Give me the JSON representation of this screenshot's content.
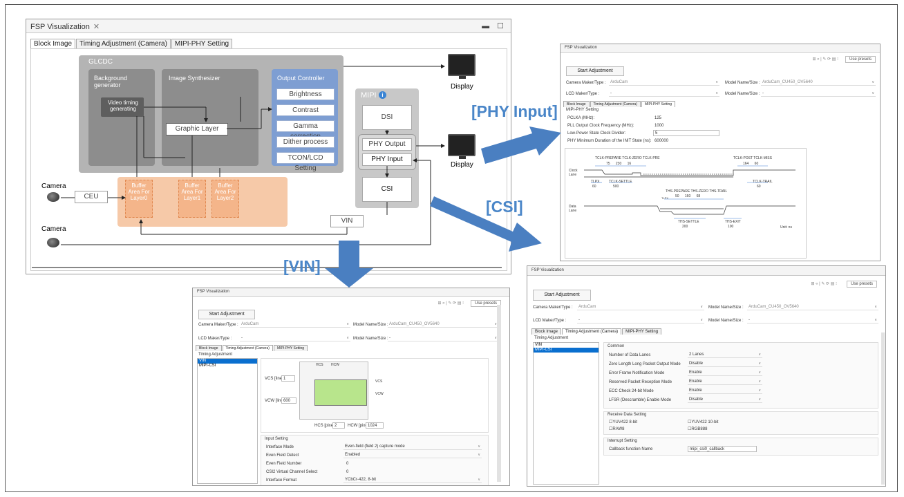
{
  "colors": {
    "accent_blue": "#4a86c8",
    "selection_blue": "#0a6fcf",
    "glcdc_gray": "#b4b4b4",
    "block_gray": "#8d8d8d",
    "output_blue": "#7e9ed2",
    "buffer_orange": "#f6c9a8"
  },
  "callouts": {
    "phy_input": "[PHY Input]",
    "csi": "[CSI]",
    "vin": "[VIN]"
  },
  "main_window": {
    "tab_title": "FSP Visualization",
    "close_glyph": "✕",
    "minmax": "▬ ☐",
    "tabs": [
      "Block Image",
      "Timing Adjustment (Camera)",
      "MIPI-PHY Setting"
    ],
    "diagram": {
      "glcdc": "GLCDC",
      "background_generator": "Background generator",
      "image_synthesizer": "Image Synthesizer",
      "video_timing": "Video timing generating",
      "graphic_layer": "Graphic Layer",
      "output_controller": "Output Controller",
      "oc_items": [
        "Brightness",
        "Contrast",
        "Gamma correction",
        "Dither process",
        "TCON/LCD Setting"
      ],
      "mipi": "MIPI",
      "mipi_info_icon": "i",
      "dsi": "DSI",
      "phy_output": "PHY Output",
      "phy_input": "PHY Input",
      "csi": "CSI",
      "vin": "VIN",
      "ceu": "CEU",
      "camera_top": "Camera",
      "camera_bottom": "Camera",
      "display_top": "Display",
      "display_bottom": "Display",
      "buffers": [
        "Buffer Area For Layer0",
        "Buffer Area For Layer1",
        "Buffer Area For Layer2"
      ]
    }
  },
  "phy_window": {
    "tab_title": "FSP Visualization",
    "use_presets": "Use presets",
    "start_adjustment": "Start Adjustment",
    "camera_maker_label": "Camera Maker/Type :",
    "camera_maker_value": "ArduCam",
    "model_name_label": "Model Name/Size :",
    "model_name_value": "ArduCam_CU450_OV5640",
    "lcd_maker_label": "LCD Maker/Type :",
    "lcd_maker_value": "-",
    "lcd_model_label": "Model Name/Size :",
    "lcd_model_value": "-",
    "tabs": [
      "Block Image",
      "Timing Adjustment (Camera)",
      "MIPI-PHY Setting"
    ],
    "section": "MIPI-PHY Setting",
    "rows": [
      {
        "label": "PCLKA (MHz):",
        "value": "125"
      },
      {
        "label": "PLL Output Clock Frequency (MHz):",
        "value": "1000"
      },
      {
        "label": "Low-Power State Clock Divider:",
        "value": "5"
      },
      {
        "label": "PHY Minimum Duration of the INIT State (ns):",
        "value": "600000"
      }
    ],
    "timing": {
      "clock_lane": "Clock Lane",
      "data_lane": "Data Lane",
      "top_labels": "TCLK-PREPARE TCLK-ZERO TCLK-PRE",
      "top_values": "75      230      16",
      "post_labels": "TCLK-POST TCLK-MISS",
      "post_values": "164      60",
      "tlpx": "TLPX",
      "tlpx_val": "60",
      "settle": "TCLK-SETTLE",
      "settle_val": "500",
      "trail": "TCLK-TRAIL",
      "trail_val": "60",
      "ths_labels": "THS-PREPARE THS-ZERO THS-TRAIL",
      "ths_values": "50      160      68",
      "tlpx2": "TLPX",
      "ths_settle": "THS-SETTLE",
      "ths_settle_val": "200",
      "ths_exit": "THS-EXIT",
      "ths_exit_val": "100",
      "unit": "Unit: ns"
    }
  },
  "vin_window": {
    "tab_title": "FSP Visualization",
    "use_presets": "Use presets",
    "start_adjustment": "Start Adjustment",
    "camera_maker_label": "Camera Maker/Type :",
    "camera_maker_value": "ArduCam",
    "model_name_label": "Model Name/Size :",
    "model_name_value": "ArduCam_CU450_OV5640",
    "lcd_maker_label": "LCD Maker/Type :",
    "lcd_maker_value": "-",
    "lcd_model_label": "Model Name/Size :",
    "lcd_model_value": "-",
    "tabs": [
      "Block Image",
      "Timing Adjustment (Camera)",
      "MIPI-PHY Setting"
    ],
    "section": "Timing Adjustment",
    "list": [
      "VIN",
      "MIPI-CSI"
    ],
    "vcs_label": "VCS [line]",
    "vcs_value": "1",
    "vcw_label": "VCW [line]",
    "vcw_value": "600",
    "hcs_label": "HCS [pixel]",
    "hcs_value": "2",
    "hcw_label": "HCW [pixel]",
    "hcw_value": "1024",
    "diag_hcs": "HCS",
    "diag_hcw": "HCW",
    "diag_vcs": "VCS",
    "diag_vcw": "VCW",
    "input_setting": "Input Setting",
    "rows": [
      {
        "label": "Interface Mode",
        "value": "Even-field (field 2) capture mode"
      },
      {
        "label": "Even Field Detect",
        "value": "Enabled"
      },
      {
        "label": "Even Field Number",
        "value": "0"
      },
      {
        "label": "CSI2 Virtual Channel Select",
        "value": "0"
      },
      {
        "label": "Interface Format",
        "value": "YCbCr-422, 8-bit"
      }
    ]
  },
  "csi_window": {
    "tab_title": "FSP Visualization",
    "use_presets": "Use presets",
    "start_adjustment": "Start Adjustment",
    "camera_maker_label": "Camera Maker/Type :",
    "camera_maker_value": "ArduCam",
    "model_name_label": "Model Name/Size :",
    "model_name_value": "ArduCam_CU450_OV5640",
    "lcd_maker_label": "LCD Maker/Type :",
    "lcd_maker_value": "-",
    "lcd_model_label": "Model Name/Size :",
    "lcd_model_value": "-",
    "tabs": [
      "Block Image",
      "Timing Adjustment (Camera)",
      "MIPI-PHY Setting"
    ],
    "section": "Timing Adjustment",
    "list": [
      "VIN",
      "MIPI-CSI"
    ],
    "common": "Common",
    "rows": [
      {
        "label": "Number of Data Lanes",
        "value": "2 Lanes"
      },
      {
        "label": "Zero Length Long Packet Output Mode",
        "value": "Disable"
      },
      {
        "label": "Error Frame Notification Mode",
        "value": "Enable"
      },
      {
        "label": "Reserved Packet Reception Mode",
        "value": "Enable"
      },
      {
        "label": "ECC Check 24-bit Mode",
        "value": "Enable"
      },
      {
        "label": "LFSR (Descramble) Enable Mode",
        "value": "Disable"
      }
    ],
    "receive": "Receive Data Setting",
    "checks": [
      "YUV422 8-bit",
      "YUV422 10-bit",
      "RAW8",
      "RGB888"
    ],
    "interrupt": "Interrupt Setting",
    "callback_label": "Callback function Name",
    "callback_value": "mipi_csi0_callback"
  }
}
